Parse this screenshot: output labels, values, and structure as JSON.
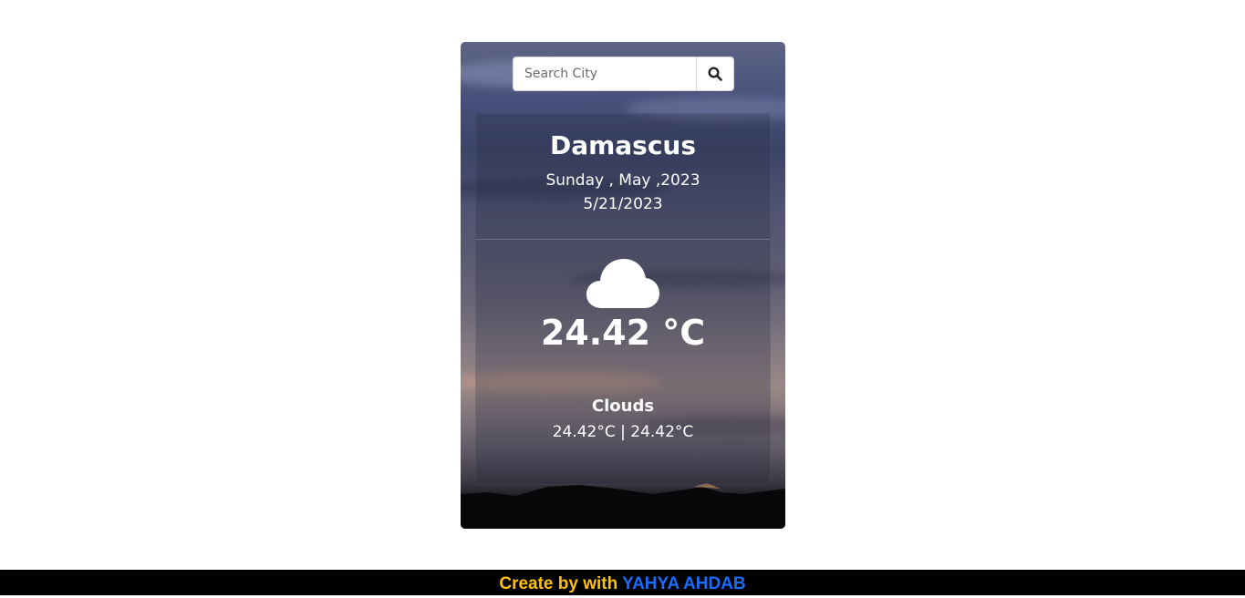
{
  "search": {
    "placeholder": "Search City",
    "button_icon": "search-icon"
  },
  "weather": {
    "city": "Damascus",
    "day_line": "Sunday , May ,2023",
    "date": "5/21/2023",
    "icon": "cloud-icon",
    "temperature": "24.42 °C",
    "condition": "Clouds",
    "min_max": "24.42°C | 24.42°C"
  },
  "footer": {
    "credit": "Create by with",
    "author": "YAHYA AHDAB",
    "credit_color": "#ffc107",
    "author_color": "#1a6bff"
  }
}
